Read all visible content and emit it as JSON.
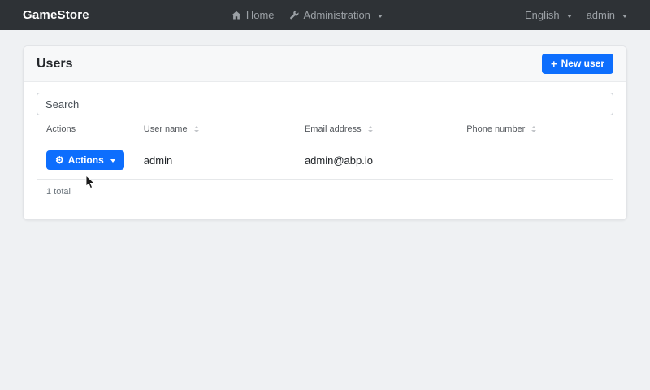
{
  "navbar": {
    "brand": "GameStore",
    "home_label": "Home",
    "administration_label": "Administration",
    "language_label": "English",
    "user_label": "admin"
  },
  "page": {
    "title": "Users",
    "new_user_label": "New user"
  },
  "search": {
    "placeholder": "Search"
  },
  "table": {
    "columns": [
      {
        "label": "Actions",
        "sortable": false
      },
      {
        "label": "User name",
        "sortable": true
      },
      {
        "label": "Email address",
        "sortable": true
      },
      {
        "label": "Phone number",
        "sortable": true
      }
    ],
    "rows": [
      {
        "actions_label": "Actions",
        "user_name": "admin",
        "email": "admin@abp.io",
        "phone": ""
      }
    ],
    "footer": {
      "total_text": "1 total"
    }
  },
  "icons": {
    "plus": "+",
    "gear": "⚙"
  },
  "colors": {
    "primary": "#0d6efd",
    "navbar_bg": "#2e3236",
    "page_bg": "#eff1f3",
    "card_header_bg": "#f7f8f9"
  }
}
